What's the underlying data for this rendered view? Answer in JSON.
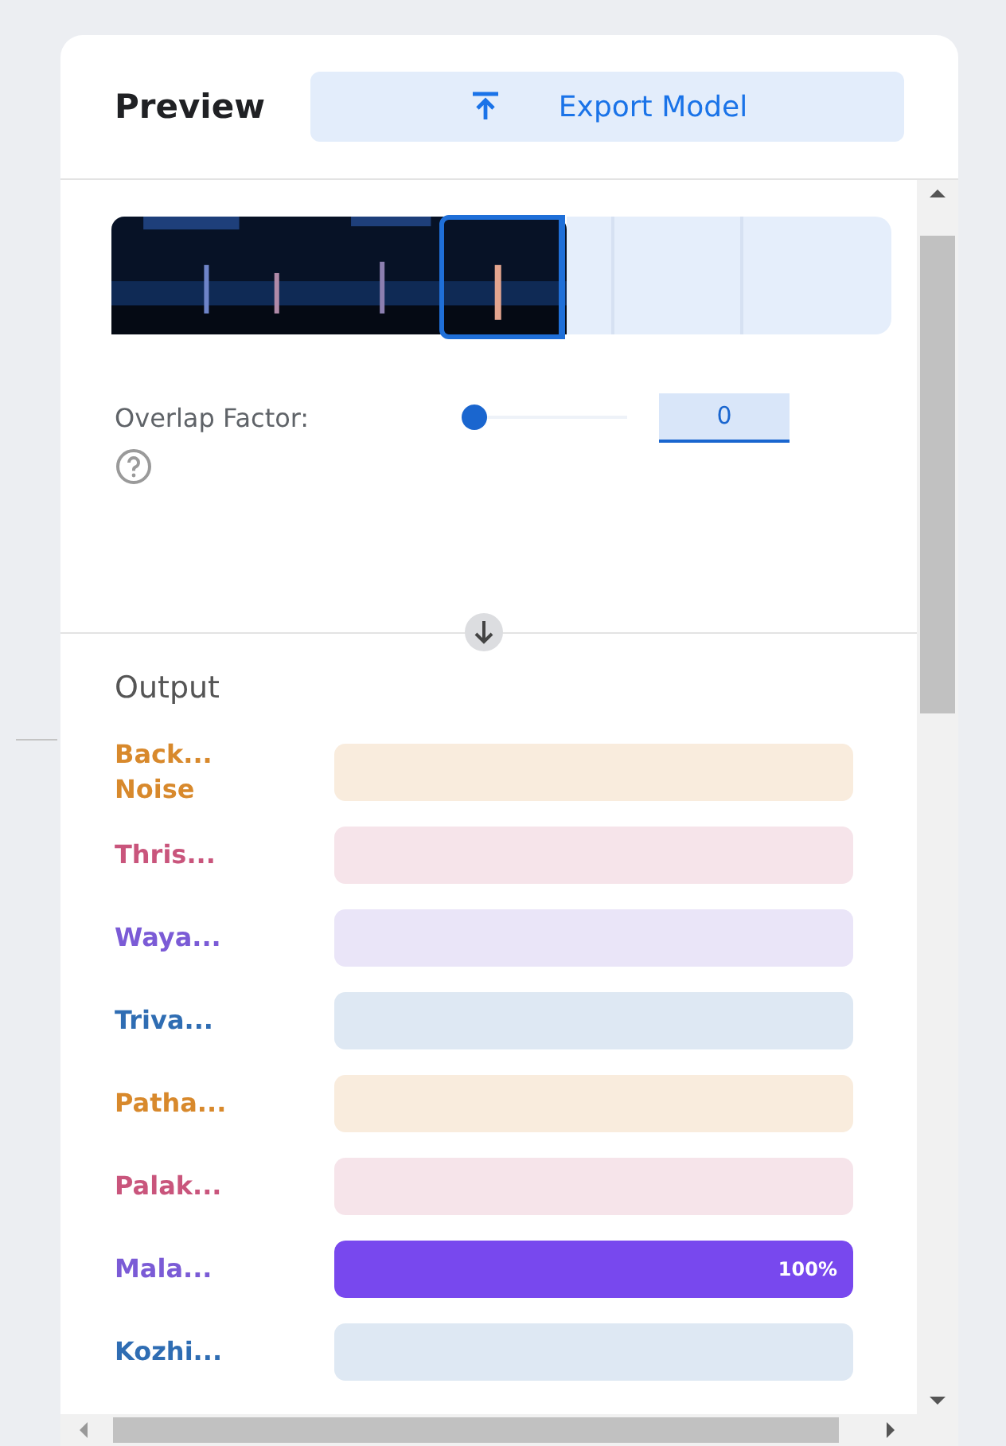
{
  "header": {
    "title": "Preview",
    "export_button": "Export Model"
  },
  "overlap": {
    "label": "Overlap Factor:",
    "level": 0,
    "value": "0"
  },
  "output": {
    "title": "Output",
    "rows": [
      {
        "label": "Back... Noise",
        "color": "#d8892c"
      },
      {
        "label": "Thris...",
        "color": "#c9557c"
      },
      {
        "label": "Waya...",
        "color": "#7b5bd6"
      },
      {
        "label": "Triva...",
        "color": "#2f6db3"
      },
      {
        "label": "Patha...",
        "color": "#d8892c"
      },
      {
        "label": "Palak...",
        "color": "#c9557c"
      },
      {
        "label": "Mala...",
        "color": "#7b5bd6",
        "level": 1,
        "reading": "100%"
      },
      {
        "label": "Kozhi...",
        "color": "#2f6db3"
      }
    ]
  }
}
